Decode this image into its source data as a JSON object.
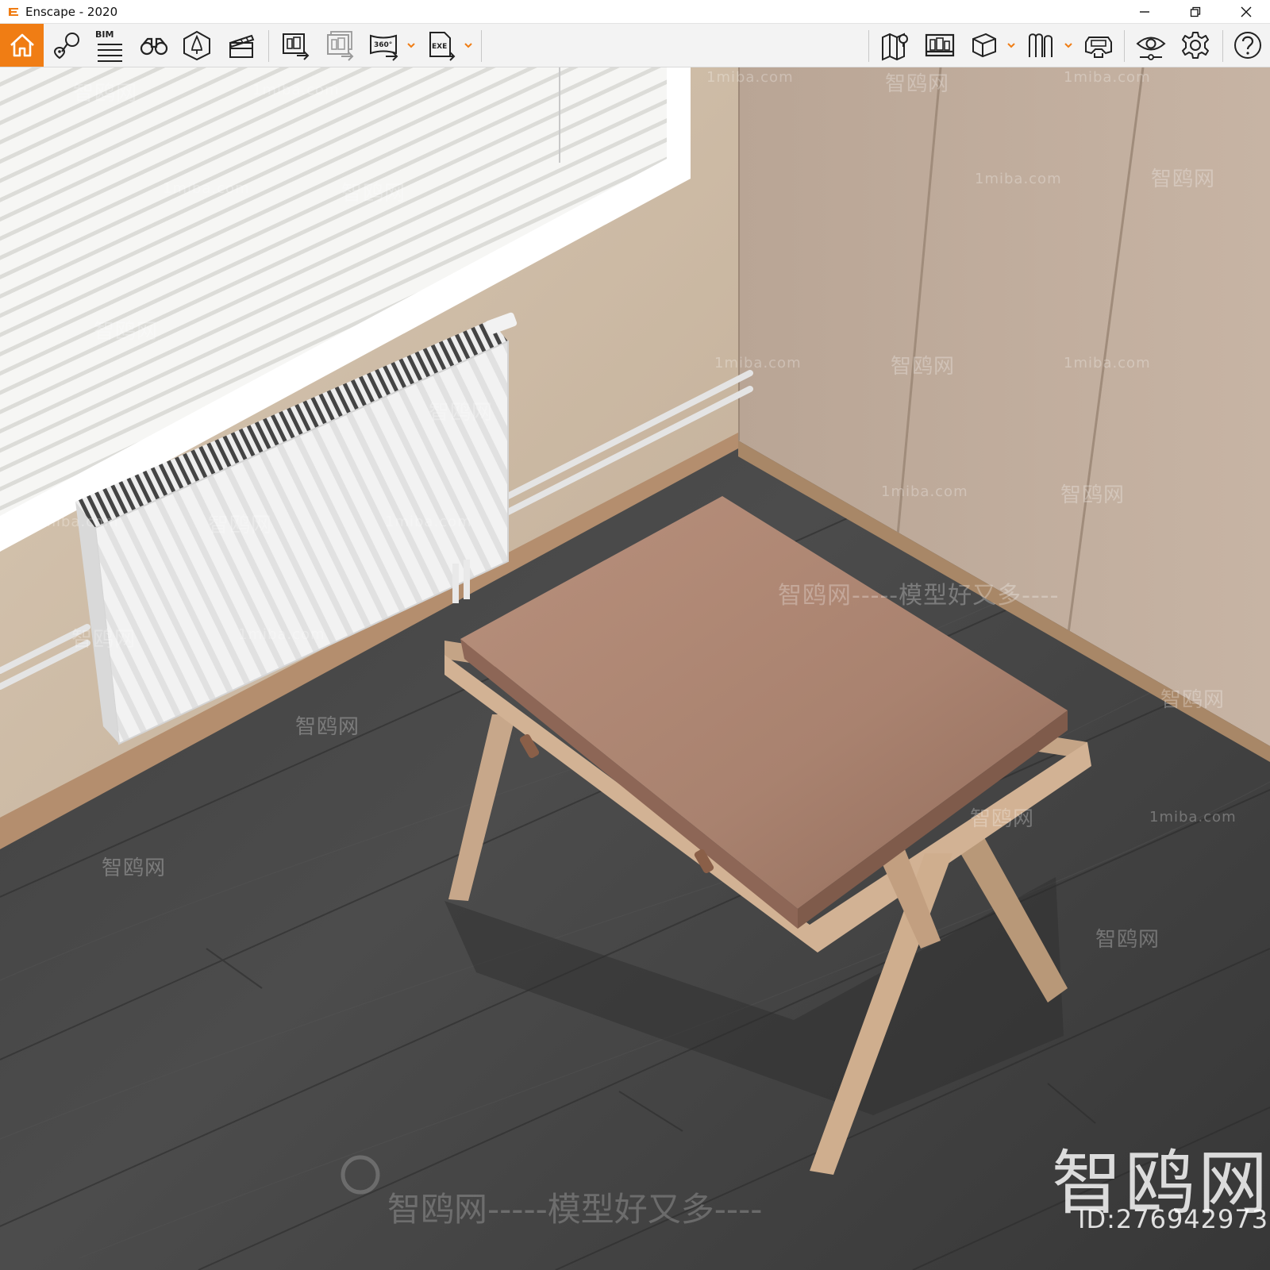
{
  "window": {
    "title": "Enscape - 2020",
    "brand_color": "#f07d14"
  },
  "title_bar_controls": {
    "minimize_icon": "minimize-icon",
    "restore_icon": "restore-icon",
    "close_icon": "close-icon"
  },
  "toolbar": {
    "left_group": [
      {
        "icon": "home-icon",
        "active": true
      },
      {
        "icon": "locate-icon"
      },
      {
        "icon": "bim-icon",
        "label": "BIM"
      },
      {
        "icon": "binoculars-icon"
      },
      {
        "icon": "asset-library-icon"
      },
      {
        "icon": "clapperboard-icon"
      }
    ],
    "export_group": [
      {
        "icon": "render-export-icon"
      },
      {
        "icon": "batch-render-icon",
        "disabled": true
      },
      {
        "icon": "panorama-export-icon",
        "label": "360°",
        "has_dropdown": true
      },
      {
        "icon": "exe-export-icon",
        "label": "EXE",
        "has_dropdown": true
      }
    ],
    "right_group": [
      {
        "icon": "map-icon"
      },
      {
        "icon": "views-manager-icon"
      },
      {
        "icon": "cube-icon",
        "has_dropdown": true
      },
      {
        "icon": "bookmarks-icon",
        "has_dropdown": true
      },
      {
        "icon": "vr-headset-icon"
      },
      {
        "icon": "visual-settings-icon"
      },
      {
        "icon": "gear-icon"
      },
      {
        "icon": "help-icon"
      }
    ],
    "collapse_icon": "chevron-up-icon"
  },
  "viewport": {
    "watermark_site": "1miba.com",
    "watermark_brand": "智鸥网",
    "watermark_slogan": "智鸥网-----模型好又多----",
    "watermark_large": "智鸥网",
    "watermark_id": "ID:276942973"
  }
}
